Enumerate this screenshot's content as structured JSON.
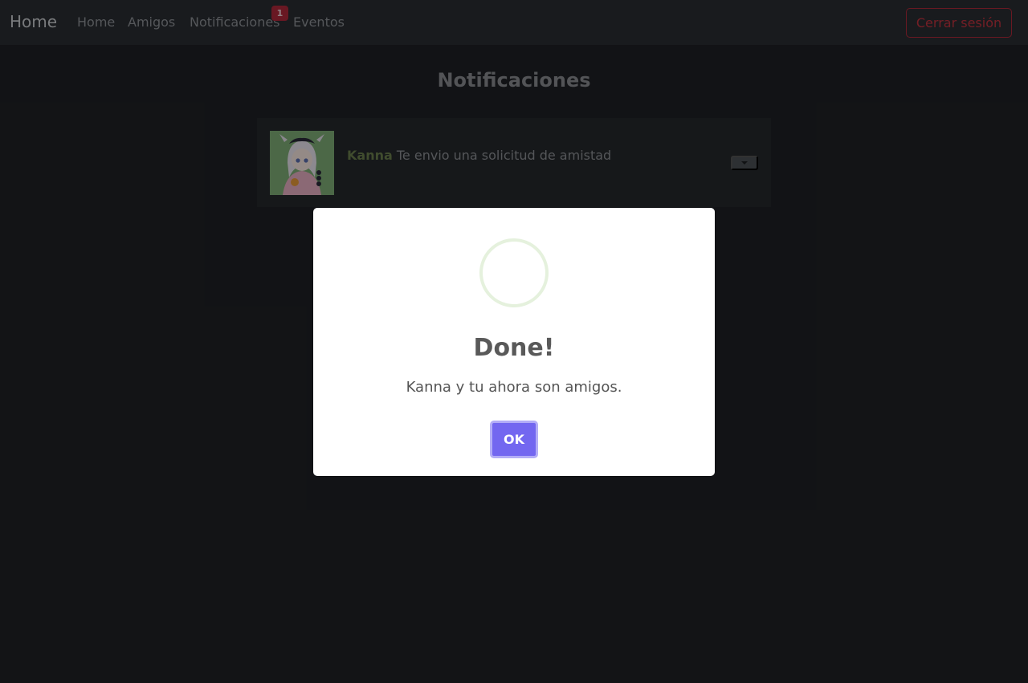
{
  "navbar": {
    "brand": "Home",
    "links": [
      {
        "label": "Home"
      },
      {
        "label": "Amigos"
      },
      {
        "label": "Notificaciones",
        "badge": "1"
      },
      {
        "label": "Eventos"
      }
    ],
    "logout_label": "Cerrar sesión"
  },
  "main": {
    "title": "Notificaciones",
    "notifications": [
      {
        "name": "Kanna",
        "message": "Te envio una solicitud de amistad"
      }
    ]
  },
  "modal": {
    "icon": "success-icon",
    "title": "Done!",
    "text": "Kanna y tu ahora son amigos.",
    "ok_label": "OK"
  },
  "colors": {
    "accent": "#7367f0",
    "danger": "#b02a3a",
    "badge": "#b0283b",
    "friend_name": "#6b7f4e"
  }
}
